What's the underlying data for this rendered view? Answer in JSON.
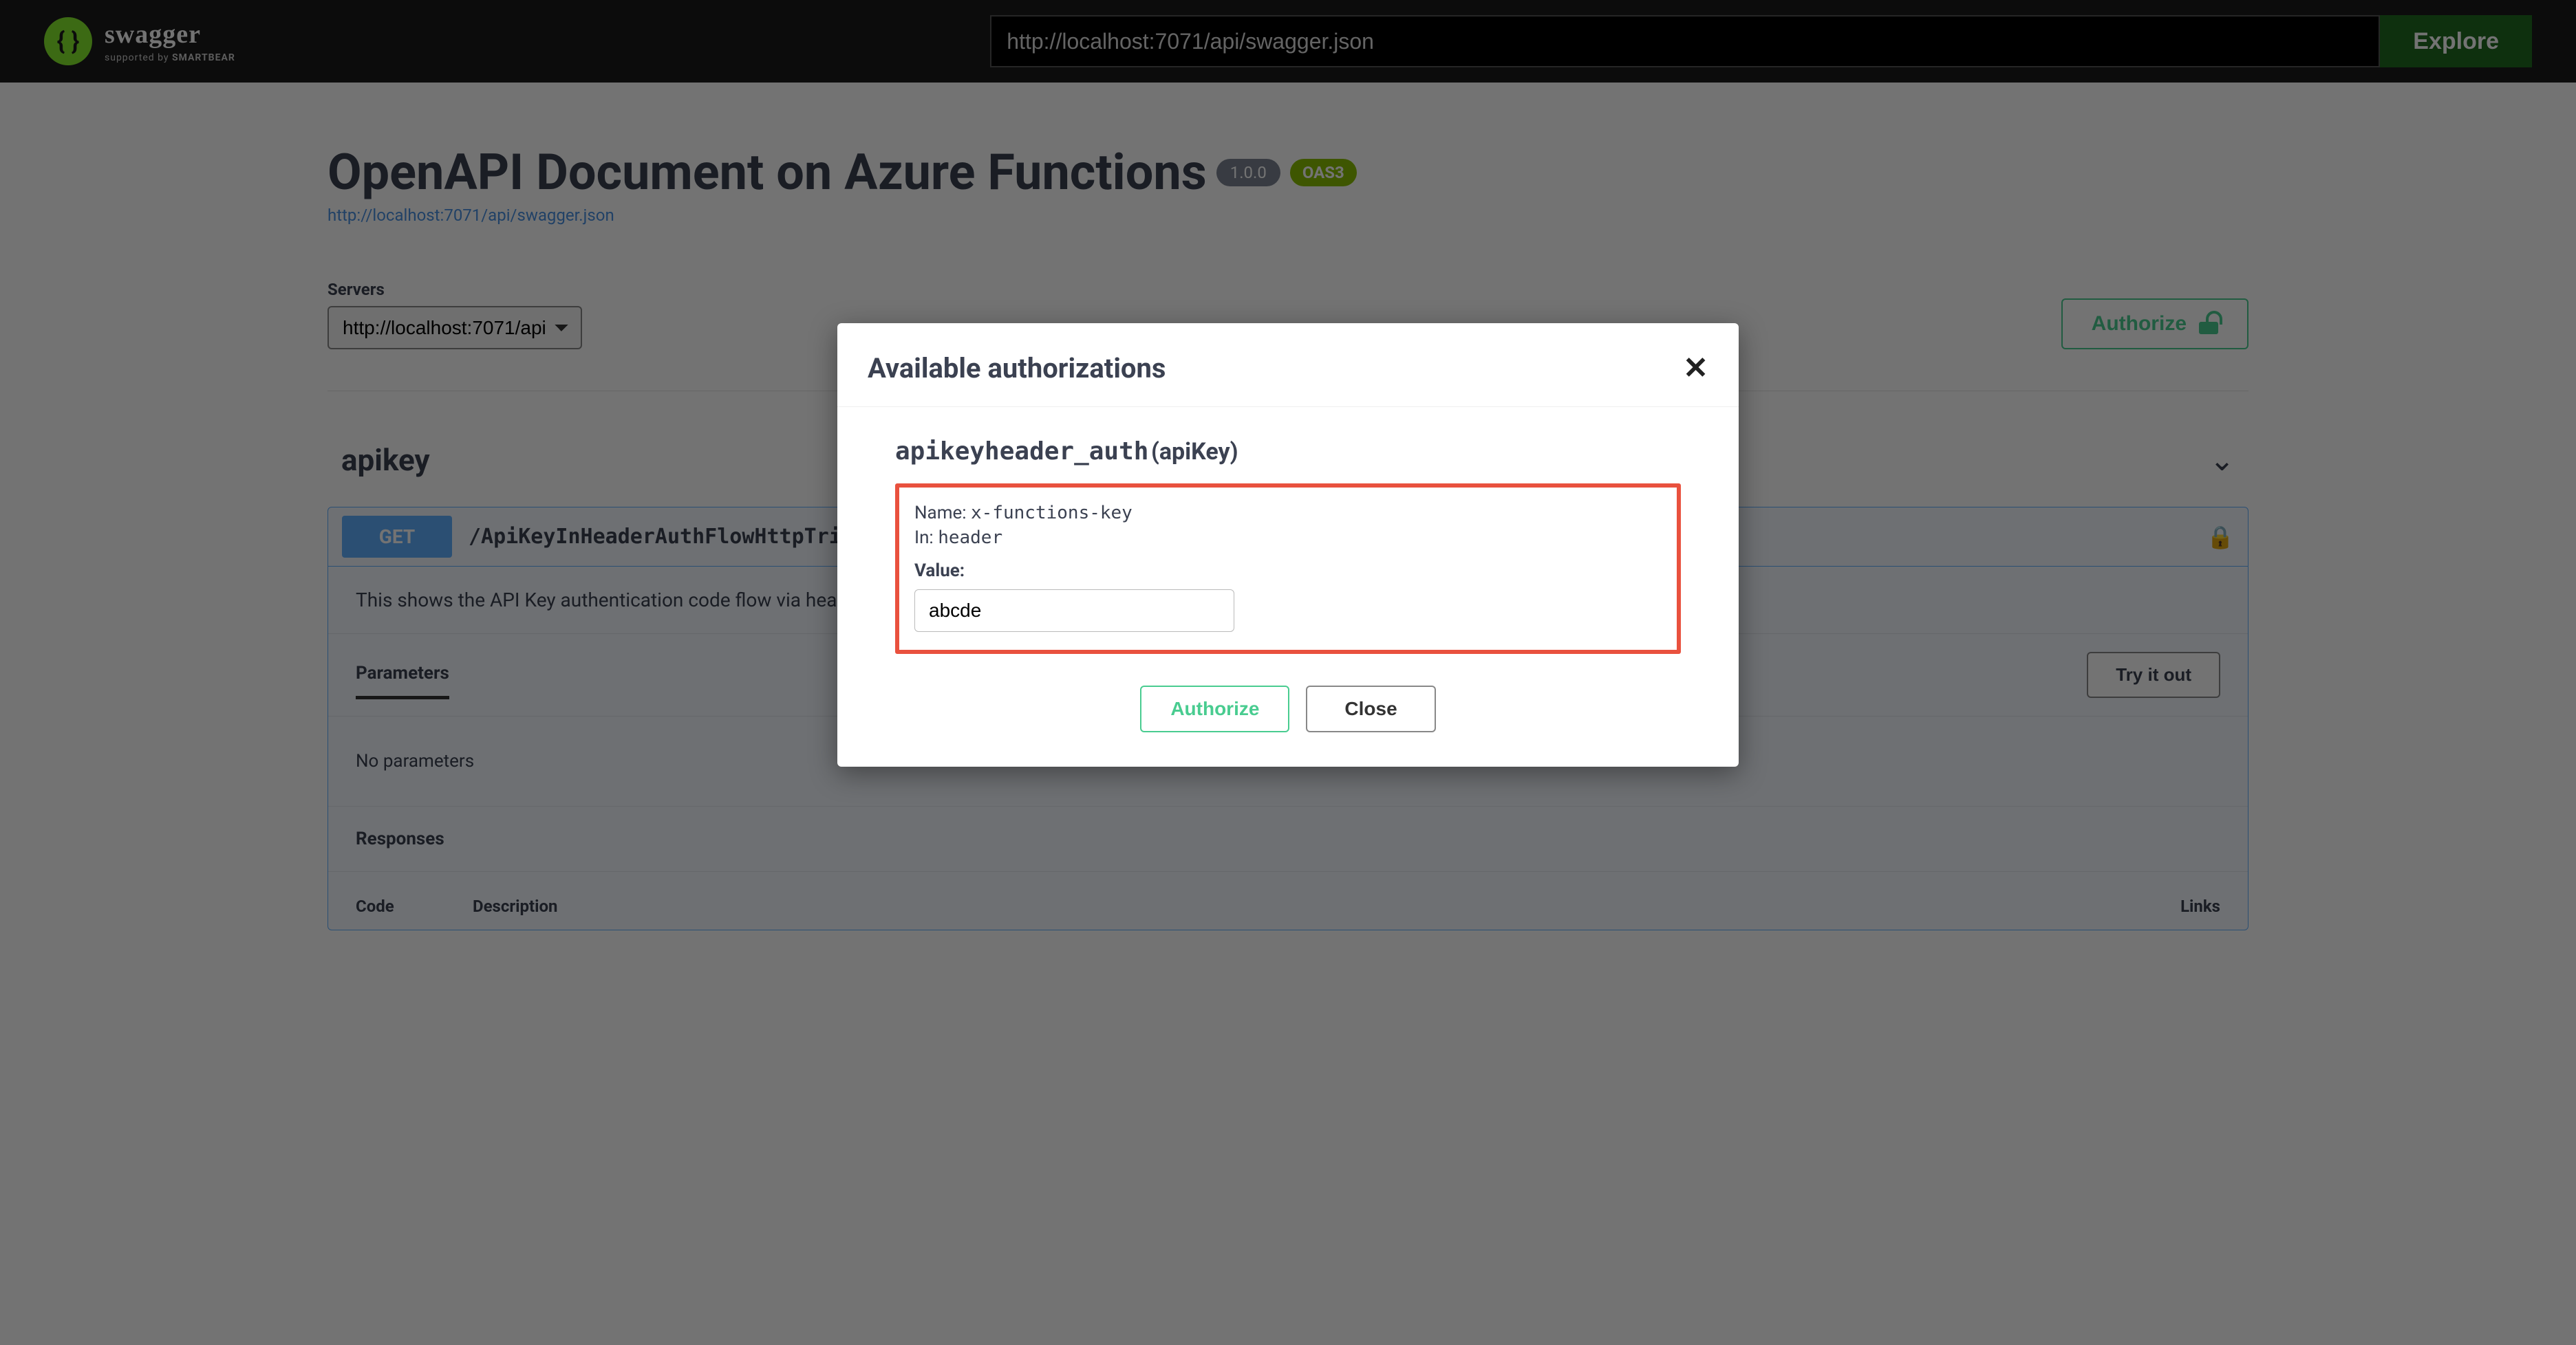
{
  "topbar": {
    "logo_text": "swagger",
    "logo_sub_prefix": "supported by ",
    "logo_sub_brand": "SMARTBEAR",
    "url_value": "http://localhost:7071/api/swagger.json",
    "explore_label": "Explore"
  },
  "info": {
    "title": "OpenAPI Document on Azure Functions",
    "version": "1.0.0",
    "oas_badge": "OAS3",
    "spec_link": "http://localhost:7071/api/swagger.json"
  },
  "servers": {
    "label": "Servers",
    "selected": "http://localhost:7071/api"
  },
  "authorize_button": "Authorize",
  "tag": {
    "name": "apikey"
  },
  "operation": {
    "method": "GET",
    "path": "/ApiKeyInHeaderAuthFlowHttpTrigger",
    "description": "This shows the API Key authentication code flow via header",
    "parameters_tab": "Parameters",
    "try_it_out": "Try it out",
    "no_parameters": "No parameters",
    "responses_label": "Responses",
    "col_code": "Code",
    "col_description": "Description",
    "col_links": "Links"
  },
  "modal": {
    "title": "Available authorizations",
    "auth_scheme_name": "apikeyheader_auth",
    "auth_scheme_type": "(apiKey)",
    "name_label": "Name:",
    "name_value": "x-functions-key",
    "in_label": "In:",
    "in_value": "header",
    "value_label": "Value:",
    "value_input": "abcde",
    "authorize_label": "Authorize",
    "close_label": "Close"
  }
}
